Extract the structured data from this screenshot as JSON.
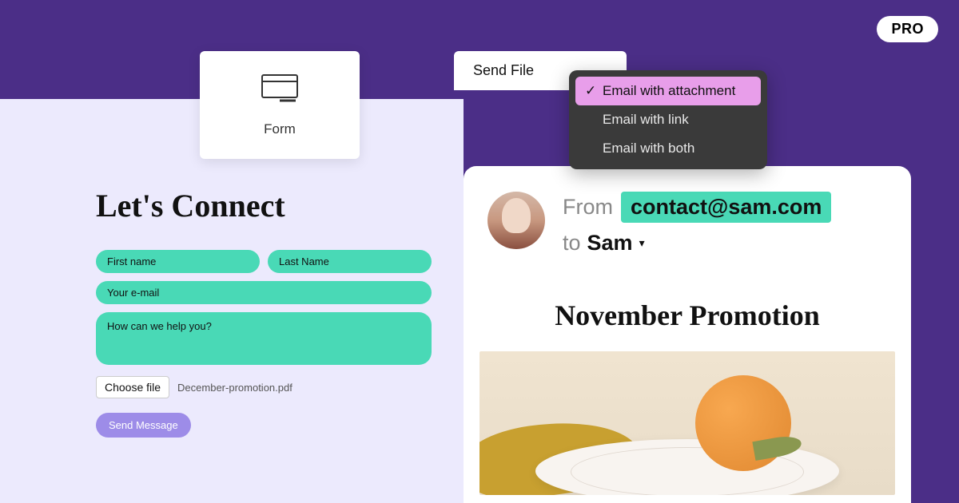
{
  "pro_badge": "PRO",
  "form_tile": {
    "label": "Form"
  },
  "send_file": {
    "tab_label": "Send File",
    "options": [
      "Email with attachment",
      "Email with link",
      "Email with both"
    ]
  },
  "contact_form": {
    "title": "Let's Connect",
    "first_name_placeholder": "First name",
    "last_name_placeholder": "Last Name",
    "email_placeholder": "Your e-mail",
    "message_placeholder": "How can we help you?",
    "choose_file_label": "Choose file",
    "filename": "December-promotion.pdf",
    "send_button": "Send Message"
  },
  "email_preview": {
    "from_label": "From",
    "from_email": "contact@sam.com",
    "to_label": "to",
    "to_name": "Sam",
    "title": "November Promotion"
  }
}
